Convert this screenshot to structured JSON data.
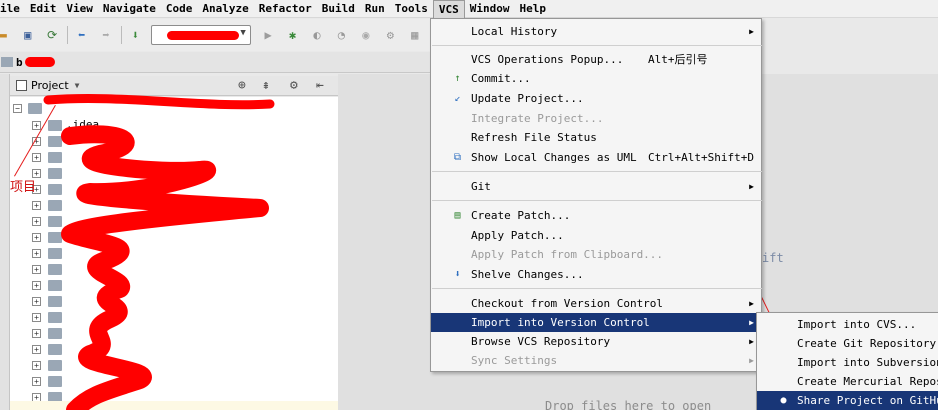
{
  "menubar": [
    "ile",
    "Edit",
    "View",
    "Navigate",
    "Code",
    "Analyze",
    "Refactor",
    "Build",
    "Run",
    "Tools",
    "VCS",
    "Window",
    "Help"
  ],
  "navbar": {
    "crumb": "b"
  },
  "project_panel": {
    "title": "Project",
    "tree": [
      ".idea"
    ]
  },
  "annotation": {
    "label": "项目"
  },
  "editor": {
    "hint_partial": "ift",
    "drop_hint": "Drop files here to open"
  },
  "vcs_menu": {
    "items": [
      {
        "label": "Local History",
        "shortcut": "",
        "submenu": true,
        "disabled": false
      },
      {
        "label": "VCS Operations Popup...",
        "shortcut": "Alt+后引号",
        "submenu": false,
        "disabled": false
      },
      {
        "label": "Commit...",
        "shortcut": "",
        "submenu": false,
        "disabled": false
      },
      {
        "label": "Update Project...",
        "shortcut": "",
        "submenu": false,
        "disabled": false
      },
      {
        "label": "Integrate Project...",
        "shortcut": "",
        "submenu": false,
        "disabled": true
      },
      {
        "label": "Refresh File Status",
        "shortcut": "",
        "submenu": false,
        "disabled": false
      },
      {
        "label": "Show Local Changes as UML",
        "shortcut": "Ctrl+Alt+Shift+D",
        "submenu": false,
        "disabled": false
      },
      {
        "label": "Git",
        "shortcut": "",
        "submenu": true,
        "disabled": false
      },
      {
        "label": "Create Patch...",
        "shortcut": "",
        "submenu": false,
        "disabled": false
      },
      {
        "label": "Apply Patch...",
        "shortcut": "",
        "submenu": false,
        "disabled": false
      },
      {
        "label": "Apply Patch from Clipboard...",
        "shortcut": "",
        "submenu": false,
        "disabled": true
      },
      {
        "label": "Shelve Changes...",
        "shortcut": "",
        "submenu": false,
        "disabled": false
      },
      {
        "label": "Checkout from Version Control",
        "shortcut": "",
        "submenu": true,
        "disabled": false
      },
      {
        "label": "Import into Version Control",
        "shortcut": "",
        "submenu": true,
        "disabled": false
      },
      {
        "label": "Browse VCS Repository",
        "shortcut": "",
        "submenu": true,
        "disabled": false
      },
      {
        "label": "Sync Settings",
        "shortcut": "",
        "submenu": true,
        "disabled": true
      }
    ]
  },
  "import_submenu": {
    "items": [
      {
        "label": "Import into CVS..."
      },
      {
        "label": "Create Git Repository..."
      },
      {
        "label": "Import into Subversion..."
      },
      {
        "label": "Create Mercurial Reposit"
      },
      {
        "label": "Share Project on GitHub"
      }
    ]
  }
}
